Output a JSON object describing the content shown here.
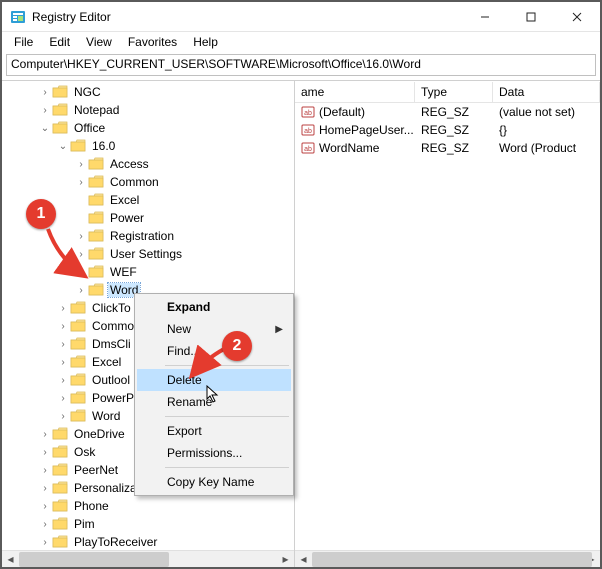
{
  "window": {
    "title": "Registry Editor"
  },
  "menu": {
    "items": [
      "File",
      "Edit",
      "View",
      "Favorites",
      "Help"
    ]
  },
  "address": {
    "path": "Computer\\HKEY_CURRENT_USER\\SOFTWARE\\Microsoft\\Office\\16.0\\Word"
  },
  "tree": {
    "items": [
      {
        "depth": 2,
        "expand": "closed",
        "label": "NGC"
      },
      {
        "depth": 2,
        "expand": "closed",
        "label": "Notepad"
      },
      {
        "depth": 2,
        "expand": "open",
        "label": "Office"
      },
      {
        "depth": 3,
        "expand": "open",
        "label": "16.0"
      },
      {
        "depth": 4,
        "expand": "closed",
        "label": "Access"
      },
      {
        "depth": 4,
        "expand": "closed",
        "label": "Common"
      },
      {
        "depth": 4,
        "expand": "none",
        "label": "Excel"
      },
      {
        "depth": 4,
        "expand": "none",
        "label": "Power"
      },
      {
        "depth": 4,
        "expand": "closed",
        "label": "Registration"
      },
      {
        "depth": 4,
        "expand": "closed",
        "label": "User Settings"
      },
      {
        "depth": 4,
        "expand": "closed",
        "label": "WEF"
      },
      {
        "depth": 4,
        "expand": "closed",
        "label": "Word",
        "selected": true
      },
      {
        "depth": 3,
        "expand": "closed",
        "label": "ClickTo"
      },
      {
        "depth": 3,
        "expand": "closed",
        "label": "Commo"
      },
      {
        "depth": 3,
        "expand": "closed",
        "label": "DmsCli"
      },
      {
        "depth": 3,
        "expand": "closed",
        "label": "Excel"
      },
      {
        "depth": 3,
        "expand": "closed",
        "label": "Outlool"
      },
      {
        "depth": 3,
        "expand": "closed",
        "label": "PowerP"
      },
      {
        "depth": 3,
        "expand": "closed",
        "label": "Word"
      },
      {
        "depth": 2,
        "expand": "closed",
        "label": "OneDrive"
      },
      {
        "depth": 2,
        "expand": "closed",
        "label": "Osk"
      },
      {
        "depth": 2,
        "expand": "closed",
        "label": "PeerNet"
      },
      {
        "depth": 2,
        "expand": "closed",
        "label": "Personaliza"
      },
      {
        "depth": 2,
        "expand": "closed",
        "label": "Phone"
      },
      {
        "depth": 2,
        "expand": "closed",
        "label": "Pim"
      },
      {
        "depth": 2,
        "expand": "closed",
        "label": "PlayToReceiver"
      }
    ]
  },
  "columns": {
    "name": "ame",
    "type": "Type",
    "data": "Data"
  },
  "values": [
    {
      "name": "(Default)",
      "type": "REG_SZ",
      "data": "(value not set)"
    },
    {
      "name": "HomePageUser...",
      "type": "REG_SZ",
      "data": "{}"
    },
    {
      "name": "WordName",
      "type": "REG_SZ",
      "data": "Word (Product"
    }
  ],
  "context_menu": {
    "items": [
      {
        "label": "Expand",
        "bold": true
      },
      {
        "label": "New",
        "submenu": true
      },
      {
        "label": "Find..."
      },
      {
        "sep": true
      },
      {
        "label": "Delete",
        "highlight": true
      },
      {
        "label": "Rename"
      },
      {
        "sep": true
      },
      {
        "label": "Export"
      },
      {
        "label": "Permissions..."
      },
      {
        "sep": true
      },
      {
        "label": "Copy Key Name"
      }
    ]
  },
  "annotations": {
    "badge1": "1",
    "badge2": "2"
  }
}
